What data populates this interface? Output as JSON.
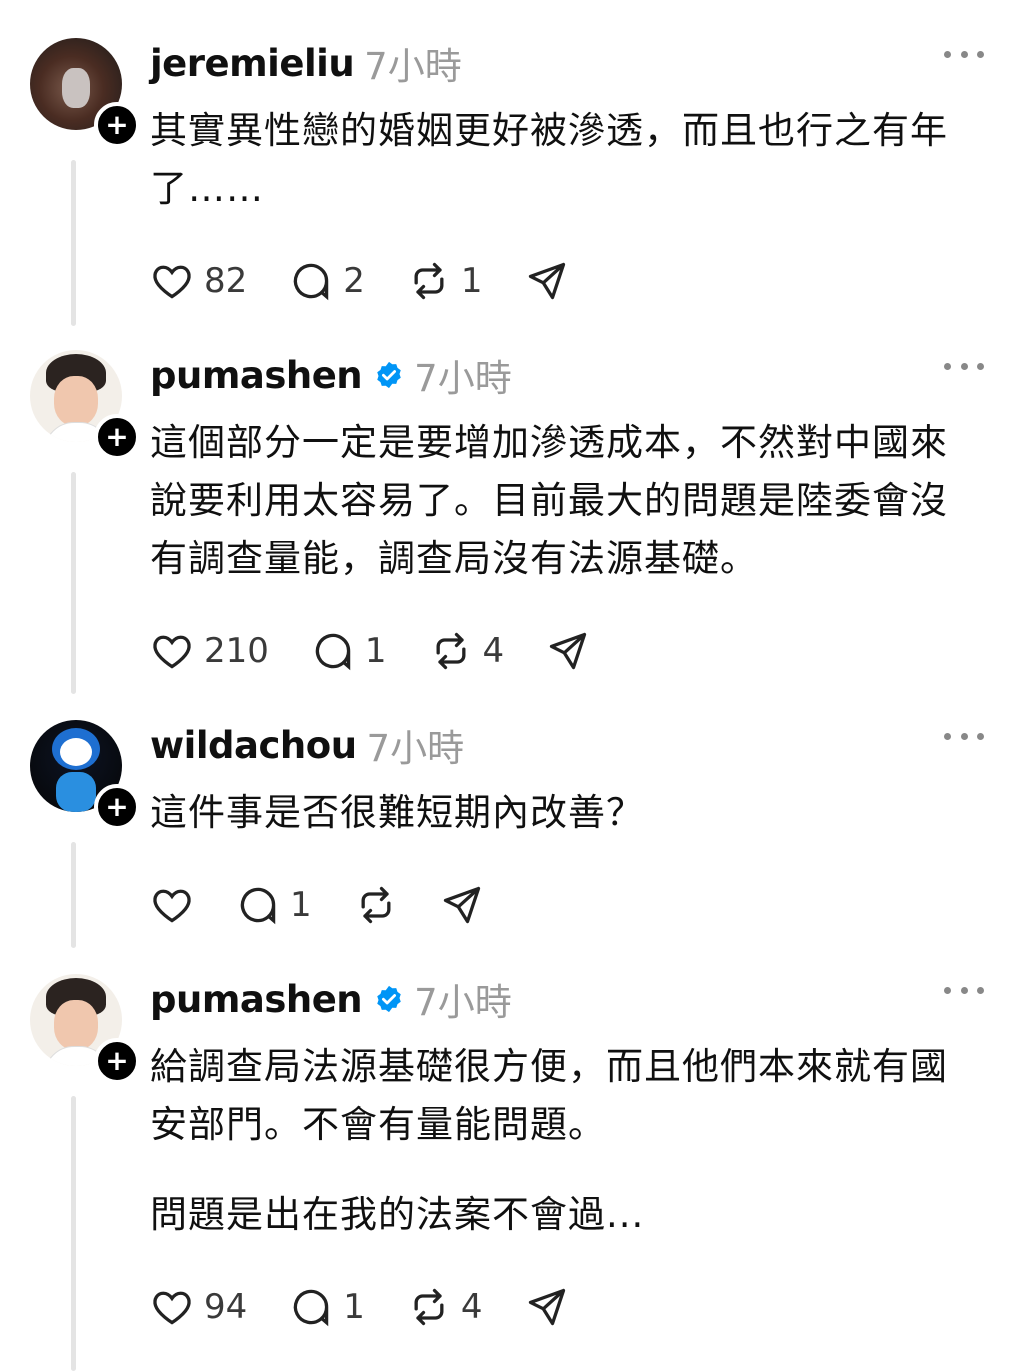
{
  "posts": [
    {
      "username": "jeremieliu",
      "time": "7小時",
      "verified": false,
      "avatar_colors": [
        "#4a2c22",
        "#1a1a1a"
      ],
      "body": [
        "其實異性戀的婚姻更好被滲透，而且也行之有年了……"
      ],
      "likes": "82",
      "replies": "2",
      "reposts": "1"
    },
    {
      "username": "pumashen",
      "time": "7小時",
      "verified": true,
      "avatar_colors": [
        "#f3e6dc",
        "#2b2320"
      ],
      "body": [
        "這個部分一定是要增加滲透成本，不然對中國來說要利用太容易了。目前最大的問題是陸委會沒有調查量能，調查局沒有法源基礎。"
      ],
      "likes": "210",
      "replies": "1",
      "reposts": "4"
    },
    {
      "username": "wildachou",
      "time": "7小時",
      "verified": false,
      "avatar_colors": [
        "#1e6fd1",
        "#101010"
      ],
      "body": [
        "這件事是否很難短期內改善？"
      ],
      "likes": "",
      "replies": "1",
      "reposts": ""
    },
    {
      "username": "pumashen",
      "time": "7小時",
      "verified": true,
      "avatar_colors": [
        "#f3e6dc",
        "#2b2320"
      ],
      "body": [
        "給調查局法源基礎很方便，而且他們本來就有國安部門。不會有量能問題。",
        "問題是出在我的法案不會過..."
      ],
      "likes": "94",
      "replies": "1",
      "reposts": "4"
    }
  ],
  "colors": {
    "verified": "#0095f6",
    "meta": "#9a9a9a",
    "line": "#e4e4e4"
  },
  "icons": {
    "like": "heart-icon",
    "reply": "comment-icon",
    "repost": "repost-icon",
    "share": "send-icon",
    "more": "more-icon",
    "follow": "plus-icon"
  }
}
